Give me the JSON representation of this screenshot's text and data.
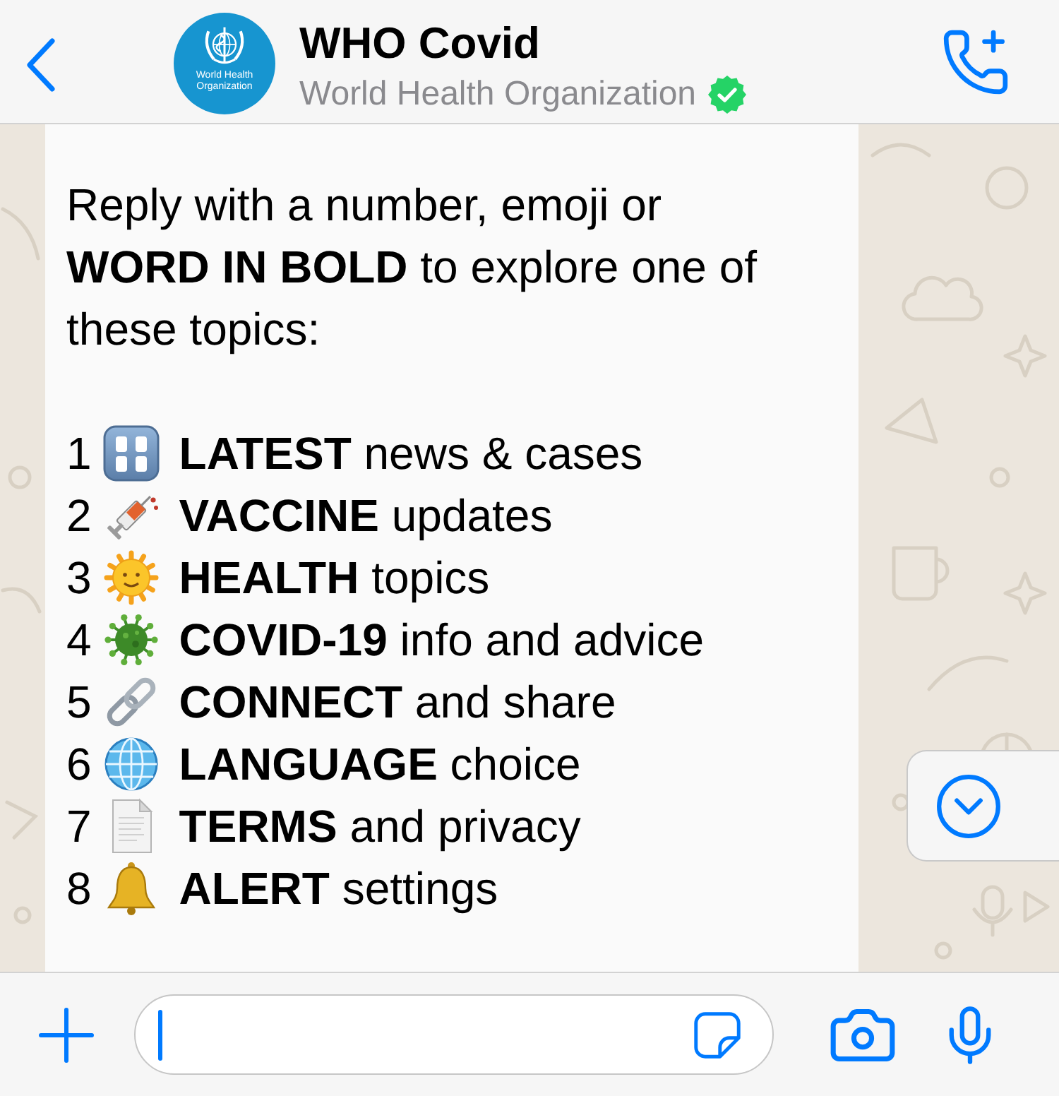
{
  "header": {
    "avatar_logo_text": [
      "World Health",
      "Organization"
    ],
    "contact_name": "WHO Covid",
    "subtitle": "World Health Organization",
    "verified": true
  },
  "message": {
    "intro": "Reply with a number, emoji or **WORD IN BOLD** to explore one of these topics:",
    "topics": [
      {
        "number": "1",
        "label": "**LATEST** news & cases"
      },
      {
        "number": "2",
        "label": "**VACCINE** updates"
      },
      {
        "number": "3",
        "label": "**HEALTH** topics"
      },
      {
        "number": "4",
        "label": "**COVID-19** info and advice"
      },
      {
        "number": "5",
        "label": "**CONNECT** and share"
      },
      {
        "number": "6",
        "label": "**LANGUAGE** choice"
      },
      {
        "number": "7",
        "label": "**TERMS** and privacy"
      },
      {
        "number": "8",
        "label": "**ALERT** settings"
      }
    ]
  },
  "composer": {
    "focused": true
  }
}
